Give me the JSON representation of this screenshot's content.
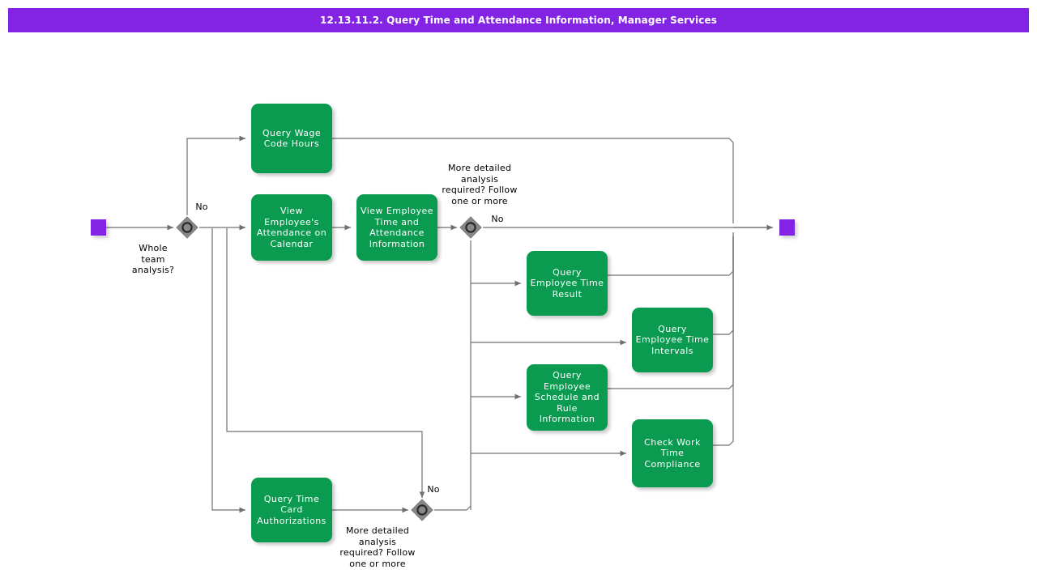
{
  "title": {
    "text": "12.13.11.2. Query Time and Attendance Information, Manager Services",
    "bar_color": "#8323E4",
    "text_color": "#FFFFFF"
  },
  "colors": {
    "task_fill": "#0B9B50",
    "task_text": "#FFFFFF",
    "event_fill": "#8323E4",
    "gateway_fill": "#888888",
    "gateway_stroke": "#555555",
    "edge_stroke": "#707070",
    "background": "#FFFFFF"
  },
  "events": [
    {
      "id": "start-event",
      "name": "start-event",
      "label": ""
    },
    {
      "id": "end-event",
      "name": "end-event",
      "label": ""
    }
  ],
  "gateways": [
    {
      "id": "gateway-whole-team",
      "type": "inclusive",
      "label": "Whole\nteam\nanalysis?",
      "branch_label": "No"
    },
    {
      "id": "gateway-more-detail-top",
      "type": "inclusive",
      "label": "More detailed\nanalysis\nrequired? Follow\none or more",
      "branch_label": "No"
    },
    {
      "id": "gateway-more-detail-bottom",
      "type": "inclusive",
      "label": "More detailed\nanalysis\nrequired? Follow\none or more",
      "branch_label": "No"
    }
  ],
  "tasks": [
    {
      "id": "task-query-wage-code-hours",
      "label": "Query Wage\nCode Hours"
    },
    {
      "id": "task-view-attendance-calendar",
      "label": "View Employee's\nAttendance on\nCalendar"
    },
    {
      "id": "task-view-time-attendance-info",
      "label": "View Employee\nTime and\nAttendance\nInformation"
    },
    {
      "id": "task-query-employee-time-result",
      "label": "Query Employee\nTime Result"
    },
    {
      "id": "task-query-employee-time-intervals",
      "label": "Query Employee\nTime Intervals"
    },
    {
      "id": "task-query-schedule-rule-info",
      "label": "Query Employee\nSchedule and\nRule Information"
    },
    {
      "id": "task-check-work-time-compliance",
      "label": "Check Work\nTime\nCompliance"
    },
    {
      "id": "task-query-time-card-authorizations",
      "label": "Query Time\nCard\nAuthorizations"
    }
  ],
  "edge_labels": {
    "gateway1_no": "No",
    "gateway2_no": "No",
    "gateway3_no": "No"
  },
  "gateway_captions": {
    "whole_team": "Whole\nteam\nanalysis?",
    "more_detail_top": "More detailed\nanalysis\nrequired? Follow\none or more",
    "more_detail_bottom": "More detailed\nanalysis\nrequired? Follow\none or more"
  }
}
